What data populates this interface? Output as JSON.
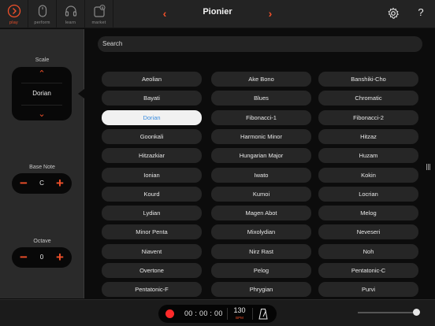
{
  "nav": {
    "tabs": [
      {
        "label": "play",
        "icon": "play-icon"
      },
      {
        "label": "perform",
        "icon": "mouse-icon"
      },
      {
        "label": "learn",
        "icon": "headphones-icon"
      },
      {
        "label": "market",
        "icon": "market-icon"
      }
    ],
    "title": "Pionier",
    "prev_glyph": "‹",
    "next_glyph": "›",
    "help_glyph": "?"
  },
  "left": {
    "scale_label": "Scale",
    "scale_value": "Dorian",
    "up_glyph": "⌃",
    "down_glyph": "⌄",
    "base_note_label": "Base Note",
    "base_note_value": "C",
    "octave_label": "Octave",
    "octave_value": "0",
    "minus_glyph": "−",
    "plus_glyph": "+"
  },
  "search": {
    "placeholder": "Search"
  },
  "scales": [
    [
      "Aeolian",
      "Ake Bono",
      "Banshiki-Cho"
    ],
    [
      "Bayati",
      "Blues",
      "Chromatic"
    ],
    [
      "Dorian",
      "Fibonacci-1",
      "Fibonacci-2"
    ],
    [
      "Goonkali",
      "Harmonic Minor",
      "Hitzaz"
    ],
    [
      "Hitzazkiar",
      "Hungarian Major",
      "Huzam"
    ],
    [
      "Ionian",
      "Iwato",
      "Kokin"
    ],
    [
      "Kourd",
      "Kumoi",
      "Locrian"
    ],
    [
      "Lydian",
      "Magen Abot",
      "Melog"
    ],
    [
      "Minor Penta",
      "Mixolydian",
      "Neveseri"
    ],
    [
      "Niavent",
      "Nirz Rast",
      "Noh"
    ],
    [
      "Overtone",
      "Pelog",
      "Pentatonic-C"
    ],
    [
      "Pentatonic-F",
      "Phrygian",
      "Purvi"
    ]
  ],
  "selected_scale": "Dorian",
  "transport": {
    "time": "00 : 00 : 00",
    "bpm": "130",
    "bpm_label": "BPM"
  },
  "volume_level": 0.96,
  "colors": {
    "accent": "#f0502a",
    "selected_text": "#3b8de0"
  }
}
